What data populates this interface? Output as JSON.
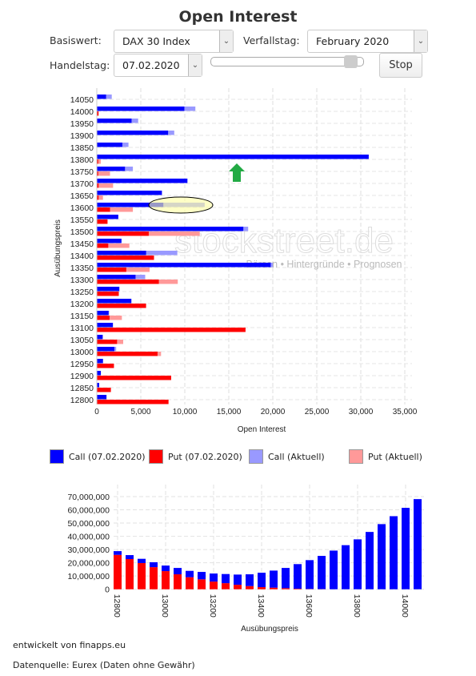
{
  "header": {
    "title": "Open Interest"
  },
  "controls": {
    "basiswert_label": "Basiswert:",
    "basiswert_value": "DAX 30 Index",
    "verfallstag_label": "Verfallstag:",
    "verfallstag_value": "February 2020",
    "handelstag_label": "Handelstag:",
    "handelstag_value": "07.02.2020",
    "slider_position": 0.95,
    "stop_label": "Stop"
  },
  "watermark": {
    "brand": "stockstreet.de",
    "tagline": "Börsen • Hintergründe • Prognosen"
  },
  "legend": [
    {
      "label": "Call (07.02.2020)",
      "color": "#0000ff"
    },
    {
      "label": "Put (07.02.2020)",
      "color": "#ff0000"
    },
    {
      "label": "Call (Aktuell)",
      "color": "#9999ff"
    },
    {
      "label": "Put (Aktuell)",
      "color": "#ff9999"
    }
  ],
  "chart_data": [
    {
      "type": "bar",
      "orientation": "horizontal",
      "xlabel": "Open Interest",
      "ylabel": "Ausübungspreis",
      "xlim": [
        0,
        36000
      ],
      "xticks": [
        0,
        5000,
        10000,
        15000,
        20000,
        25000,
        30000,
        35000
      ],
      "xtick_labels": [
        "0",
        "5,000",
        "10,000",
        "15,000",
        "20,000",
        "25,000",
        "30,000",
        "35,000"
      ],
      "grid": true,
      "categories": [
        "12800",
        "12850",
        "12900",
        "12950",
        "13000",
        "13050",
        "13100",
        "13150",
        "13200",
        "13250",
        "13300",
        "13350",
        "13400",
        "13450",
        "13500",
        "13550",
        "13600",
        "13650",
        "13700",
        "13750",
        "13800",
        "13850",
        "13900",
        "13950",
        "14000",
        "14050"
      ],
      "series": [
        {
          "name": "Call (Aktuell)",
          "color": "#9999ff",
          "values": [
            1100,
            270,
            460,
            700,
            2200,
            670,
            1830,
            1400,
            3900,
            2560,
            5500,
            20000,
            9150,
            2800,
            17200,
            2440,
            12260,
            6800,
            8750,
            4100,
            16100,
            3600,
            8800,
            4700,
            11200,
            1700
          ]
        },
        {
          "name": "Call (07.02.2020)",
          "color": "#0000ff",
          "values": [
            1100,
            270,
            460,
            700,
            2000,
            670,
            1830,
            1340,
            3930,
            2560,
            4400,
            19760,
            5600,
            2800,
            16650,
            2440,
            7560,
            7400,
            10300,
            3200,
            30900,
            2900,
            8100,
            3950,
            9950,
            1050
          ]
        },
        {
          "name": "Put (Aktuell)",
          "color": "#ff9999",
          "values": [
            8100,
            1500,
            8100,
            1750,
            7300,
            3000,
            16000,
            2850,
            5250,
            2450,
            9200,
            6000,
            6150,
            3700,
            11700,
            1250,
            4100,
            700,
            1850,
            1500,
            450,
            0,
            0,
            0,
            0,
            0
          ]
        },
        {
          "name": "Put (07.02.2020)",
          "color": "#ff0000",
          "values": [
            8150,
            1600,
            8450,
            1950,
            6900,
            2300,
            16900,
            1450,
            5600,
            2500,
            7050,
            3350,
            6500,
            1300,
            5900,
            1200,
            1500,
            200,
            200,
            150,
            150,
            0,
            0,
            0,
            200,
            0
          ]
        }
      ],
      "annotations": [
        {
          "type": "highlight-ellipse",
          "category": "13600"
        },
        {
          "type": "arrow-up",
          "color": "#22aa44",
          "category": "13800"
        }
      ]
    },
    {
      "type": "bar",
      "stacked": true,
      "xlabel": "Ausübungspreis",
      "ylabel": "",
      "ylim": [
        0,
        70000000
      ],
      "yticks": [
        0,
        10000000,
        20000000,
        30000000,
        40000000,
        50000000,
        60000000,
        70000000
      ],
      "ytick_labels": [
        "0",
        "10,000,000",
        "20,000,000",
        "30,000,000",
        "40,000,000",
        "50,000,000",
        "60,000,000",
        "70,000,000"
      ],
      "xtick_labels": [
        "12800",
        "13000",
        "13200",
        "13400",
        "13600",
        "13800",
        "14000"
      ],
      "grid": true,
      "categories": [
        "12800",
        "12850",
        "12900",
        "12950",
        "13000",
        "13050",
        "13100",
        "13150",
        "13200",
        "13250",
        "13300",
        "13350",
        "13400",
        "13450",
        "13500",
        "13550",
        "13600",
        "13650",
        "13700",
        "13750",
        "13800",
        "13850",
        "13900",
        "13950",
        "14000",
        "14050"
      ],
      "series": [
        {
          "name": "Put",
          "color": "#ff0000",
          "values": [
            26000000,
            22800000,
            19800000,
            16700000,
            13700000,
            11300000,
            9100000,
            7500000,
            5800000,
            4600000,
            3400000,
            2400000,
            1600000,
            1200000,
            800000,
            400000,
            200000,
            100000,
            0,
            0,
            0,
            0,
            0,
            0,
            0,
            0
          ]
        },
        {
          "name": "Call",
          "color": "#0000ff",
          "values": [
            2800000,
            3000000,
            3200000,
            3700000,
            4200000,
            4800000,
            4800000,
            5600000,
            6100000,
            6900000,
            7700000,
            8900000,
            10900000,
            12900000,
            15300000,
            18600000,
            21800000,
            25100000,
            29200000,
            33300000,
            37700000,
            43300000,
            49200000,
            55200000,
            61500000,
            68100000
          ]
        }
      ]
    }
  ],
  "footer": {
    "developer": "entwickelt von finapps.eu",
    "source": "Datenquelle: Eurex (Daten ohne Gewähr)"
  }
}
